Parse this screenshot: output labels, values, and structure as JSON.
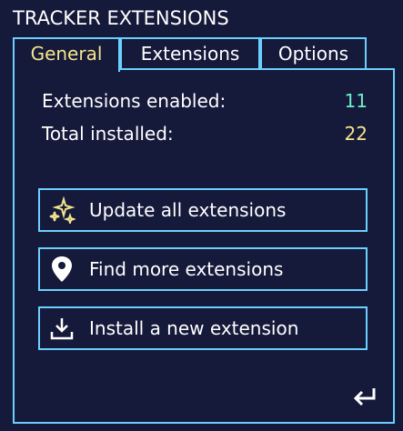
{
  "window": {
    "title": "TRACKER EXTENSIONS"
  },
  "tabs": [
    {
      "label": "General",
      "active": true
    },
    {
      "label": "Extensions",
      "active": false
    },
    {
      "label": "Options",
      "active": false
    }
  ],
  "stats": {
    "enabled_label": "Extensions enabled:",
    "enabled_value": "11",
    "installed_label": "Total installed:",
    "installed_value": "22"
  },
  "actions": [
    {
      "label": "Update all extensions",
      "icon": "sparkle-icon"
    },
    {
      "label": "Find more extensions",
      "icon": "location-pin-icon"
    },
    {
      "label": "Install a new extension",
      "icon": "download-icon"
    }
  ],
  "footer": {
    "icon": "return-icon"
  },
  "colors": {
    "background": "#15193a",
    "border": "#6cd0ff",
    "active_tab": "#f5e58a",
    "enabled_value": "#6ef0c8",
    "installed_value": "#f5e58a"
  }
}
